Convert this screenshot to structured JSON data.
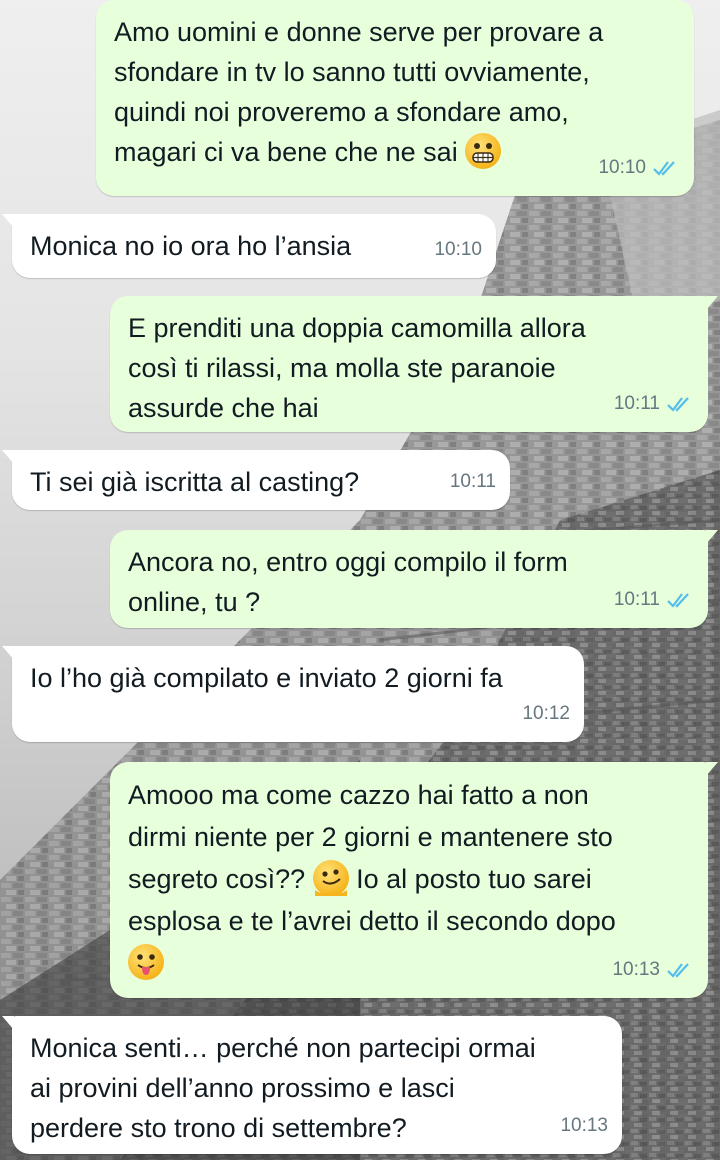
{
  "colors": {
    "outgoing_bubble": "#e7ffdb",
    "incoming_bubble": "#ffffff",
    "read_check": "#53bdeb",
    "meta_text": "#667781"
  },
  "messages": [
    {
      "direction": "outgoing",
      "lines": [
        "Amo uomini e donne serve per provare a",
        "sfondare in tv lo sanno tutti ovviamente,",
        "quindi noi proveremo a sfondare amo,",
        "magari ci va bene che ne sai"
      ],
      "emoji": "grimacing-face-emoji",
      "time": "10:10",
      "status": "read"
    },
    {
      "direction": "incoming",
      "lines": [
        "Monica no io ora ho l’ansia"
      ],
      "time": "10:10"
    },
    {
      "direction": "outgoing",
      "lines": [
        "E prenditi una doppia camomilla allora",
        "così ti rilassi, ma molla ste paranoie",
        "assurde che hai"
      ],
      "time": "10:11",
      "status": "read"
    },
    {
      "direction": "incoming",
      "lines": [
        "Ti sei già iscritta al casting?"
      ],
      "time": "10:11"
    },
    {
      "direction": "outgoing",
      "lines": [
        "Ancora no, entro oggi compilo il form",
        "online, tu ?"
      ],
      "time": "10:11",
      "status": "read"
    },
    {
      "direction": "incoming",
      "lines": [
        "Io l’ho già compilato e inviato 2 giorni fa"
      ],
      "time": "10:12"
    },
    {
      "direction": "outgoing",
      "lines": [
        "Amooo ma come cazzo hai fatto a non",
        "dirmi niente per 2 giorni e mantenere sto",
        "segreto così??",
        "Io al posto tuo sarei",
        "esplosa e te l’avrei detto il secondo dopo"
      ],
      "emojis": [
        "melting-face-emoji",
        "tongue-out-face-emoji"
      ],
      "time": "10:13",
      "status": "read"
    },
    {
      "direction": "incoming",
      "lines": [
        "Monica senti… perché non partecipi ormai",
        "ai provini dell’anno prossimo e lasci",
        "perdere sto trono di settembre?"
      ],
      "time": "10:13"
    }
  ]
}
